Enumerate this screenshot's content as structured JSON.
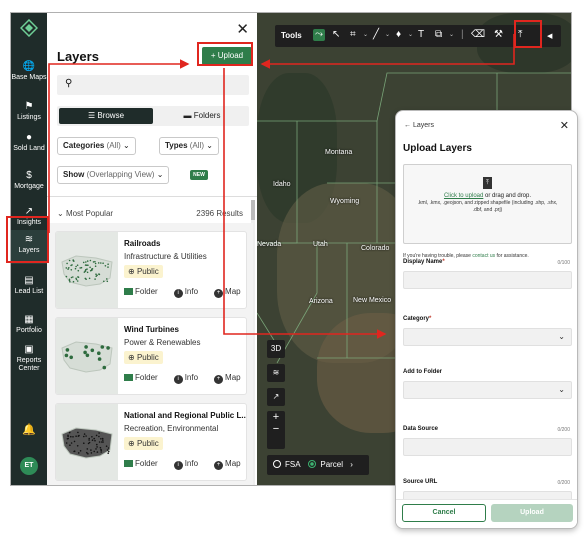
{
  "nav": {
    "items": [
      {
        "label": "Base Maps",
        "icon": "globe-icon",
        "glyph": "🌐"
      },
      {
        "label": "Listings",
        "icon": "flag-icon",
        "glyph": "⚑"
      },
      {
        "label": "Sold Land",
        "icon": "map-pin-icon",
        "glyph": "●"
      },
      {
        "label": "Mortgage",
        "icon": "dollar-icon",
        "glyph": "$"
      },
      {
        "label": "Insights",
        "icon": "trend-icon",
        "glyph": "↗"
      },
      {
        "label": "Layers",
        "icon": "layers-icon",
        "glyph": "≋"
      },
      {
        "label": "Lead List",
        "icon": "id-card-icon",
        "glyph": "▤"
      },
      {
        "label": "Portfolio",
        "icon": "map-icon",
        "glyph": "▦"
      },
      {
        "label": "Reports Center",
        "icon": "briefcase-icon",
        "glyph": "▣"
      }
    ],
    "avatar_initials": "ET"
  },
  "layers_panel": {
    "title": "Layers",
    "close_glyph": "✕",
    "upload_button": "+ Upload",
    "tabs": {
      "browse": "Browse",
      "folders": "Folders"
    },
    "filters": {
      "categories_label": "Categories",
      "categories_value": "(All)",
      "types_label": "Types",
      "types_value": "(All)",
      "show_label": "Show",
      "show_value": "(Overlapping View)",
      "new_badge": "NEW"
    },
    "sort_label": "Most Popular",
    "results_count": "2396 Results",
    "cards": [
      {
        "name": "Railroads",
        "category": "Infrastructure & Utilities",
        "visibility": "Public"
      },
      {
        "name": "Wind Turbines",
        "category": "Power & Renewables",
        "visibility": "Public"
      },
      {
        "name": "National and Regional Public L...",
        "category": "Recreation, Environmental",
        "visibility": "Public"
      }
    ],
    "card_actions": {
      "folder": "Folder",
      "info": "Info",
      "map": "Map"
    }
  },
  "map": {
    "toolbar_label": "Tools",
    "state_labels": [
      {
        "name": "Montana"
      },
      {
        "name": "Idaho"
      },
      {
        "name": "Wyoming"
      },
      {
        "name": "Utah"
      },
      {
        "name": "Colorado"
      },
      {
        "name": "Nevada"
      },
      {
        "name": "Arizona"
      },
      {
        "name": "New Mexico"
      }
    ],
    "view_3d": "3D",
    "zoom_in": "+",
    "zoom_out": "−",
    "fsa_label": "FSA",
    "parcel_label": "Parcel",
    "parcel_selected": true
  },
  "upload_modal": {
    "back_label": "Layers",
    "title": "Upload Layers",
    "drop_link": "Click to upload",
    "drop_text": " or drag and drop.",
    "drop_formats": ".kml, .kmx, .geojson, and zipped shapefile (including .shp, .shx, .dbf, and .prj)",
    "trouble_text": "If you're having trouble, please ",
    "trouble_link": "contact us",
    "trouble_tail": " for assistance.",
    "fields": [
      {
        "label": "Display Name",
        "required": true,
        "count": "0/100",
        "type": "text"
      },
      {
        "label": "Category",
        "required": true,
        "count": "",
        "type": "select"
      },
      {
        "label": "Add to Folder",
        "required": false,
        "count": "",
        "type": "select"
      },
      {
        "label": "Data Source",
        "required": false,
        "count": "0/200",
        "type": "text"
      },
      {
        "label": "Source URL",
        "required": false,
        "count": "0/200",
        "type": "text"
      }
    ],
    "cancel_button": "Cancel",
    "upload_button": "Upload"
  },
  "colors": {
    "brand_green": "#2f7d4a",
    "rail_dark": "#1f2c2a",
    "highlight_red": "#e0261f"
  }
}
